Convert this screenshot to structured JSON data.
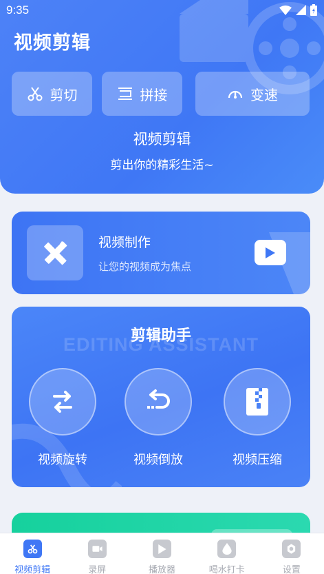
{
  "status_bar": {
    "time": "9:35"
  },
  "header": {
    "app_title": "视频剪辑",
    "tools": [
      {
        "label": "剪切",
        "icon": "scissors-icon"
      },
      {
        "label": "拼接",
        "icon": "join-icon"
      },
      {
        "label": "变速",
        "icon": "speedometer-icon"
      }
    ],
    "hero_title": "视频剪辑",
    "hero_subtitle": "剪出你的精彩生活~"
  },
  "make_card": {
    "title": "视频制作",
    "subtitle": "让您的视频成为焦点",
    "icon": "pencil-ruler-icon",
    "action_icon": "play-icon"
  },
  "assistant": {
    "title": "剪辑助手",
    "bg_text": "EDITING ASSISTANT",
    "items": [
      {
        "label": "视频旋转",
        "icon": "rotate-icon"
      },
      {
        "label": "视频倒放",
        "icon": "reverse-icon"
      },
      {
        "label": "视频压缩",
        "icon": "zip-icon"
      }
    ]
  },
  "bottom_nav": {
    "items": [
      {
        "label": "视频剪辑",
        "icon": "scissors-icon",
        "active": true
      },
      {
        "label": "录屏",
        "icon": "camera-icon",
        "active": false
      },
      {
        "label": "播放器",
        "icon": "play-icon",
        "active": false
      },
      {
        "label": "喝水打卡",
        "icon": "water-drop-icon",
        "active": false
      },
      {
        "label": "设置",
        "icon": "gear-icon",
        "active": false
      }
    ]
  },
  "colors": {
    "primary": "#3f77f5",
    "background": "#eef1f8",
    "green_card": "#16d19d",
    "nav_inactive": "#a8abb3"
  }
}
